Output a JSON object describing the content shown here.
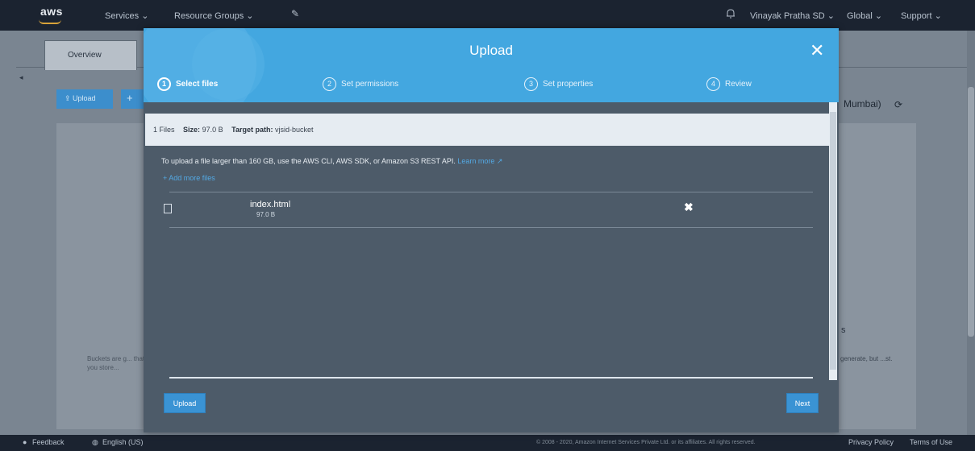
{
  "nav": {
    "logo": "aws",
    "services": "Services ⌄",
    "resource_groups": "Resource Groups ⌄",
    "pin": "✎",
    "account": "Vinayak Pratha SD ⌄",
    "region": "Global ⌄",
    "support": "Support ⌄"
  },
  "background": {
    "tab_overview": "Overview",
    "upload_button": "⇪ Upload",
    "plus_button": "+",
    "region_label": "Mumbai)",
    "refresh": "⟳",
    "panel_text_left": "Buckets are g... that you store...",
    "right_s": "s",
    "panel_text_right": "generate, but ...st."
  },
  "modal": {
    "title": "Upload",
    "close": "✕",
    "steps": [
      {
        "num": "1",
        "label": "Select files"
      },
      {
        "num": "2",
        "label": "Set permissions"
      },
      {
        "num": "3",
        "label": "Set properties"
      },
      {
        "num": "4",
        "label": "Review"
      }
    ],
    "info": {
      "files": "1 Files",
      "size_label": "Size:",
      "size_value": "97.0 B",
      "target_label": "Target path:",
      "target_value": "vjsid-bucket"
    },
    "limit_text": "To upload a file larger than 160 GB, use the AWS CLI, AWS SDK, or Amazon S3 REST API.",
    "learn_more": "Learn more ↗",
    "add_more": "+ Add more files",
    "file": {
      "name": "index.html",
      "size": "97.0 B",
      "remove": "✖"
    },
    "upload_button": "Upload",
    "next_button": "Next"
  },
  "footer": {
    "feedback": "Feedback",
    "language": "English (US)",
    "copyright": "© 2008 - 2020, Amazon Internet Services Private Ltd. or its affiliates. All rights reserved.",
    "privacy": "Privacy Policy",
    "terms": "Terms of Use"
  },
  "colors": {
    "nav_bg": "#1b2330",
    "modal_header": "#43a7e0",
    "modal_body": "#4d5b69",
    "accent_button": "#3a93d4",
    "link": "#53a9e4"
  }
}
